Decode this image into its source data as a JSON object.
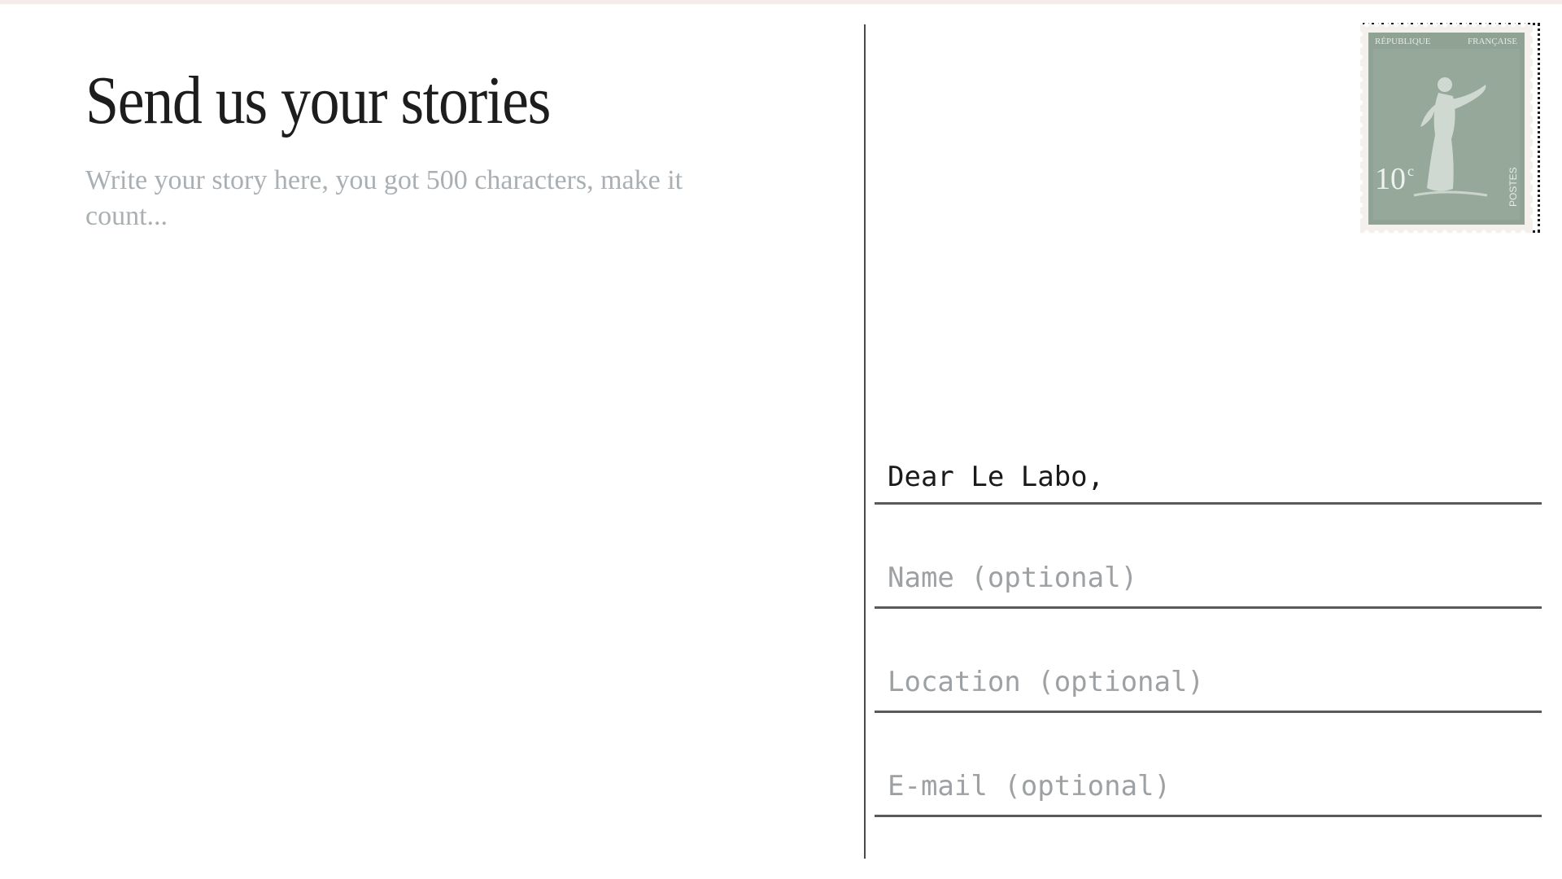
{
  "postcard": {
    "title": "Send us your stories",
    "story_placeholder": "Write your story here, you got 500 characters, make it count...",
    "greeting": "Dear Le Labo,",
    "name_placeholder": "Name (optional)",
    "location_placeholder": "Location (optional)",
    "email_placeholder": "E-mail (optional)"
  },
  "stamp": {
    "top_text_left": "RÉPUBLIQUE",
    "top_text_right": "FRANÇAISE",
    "value": "10",
    "value_unit": "c",
    "side_text": "POSTES"
  },
  "colors": {
    "stamp_green": "#8fa294",
    "stamp_light": "#c8d3c9",
    "placeholder_gray": "#9ea1a3",
    "ink": "#1d1d1d"
  }
}
